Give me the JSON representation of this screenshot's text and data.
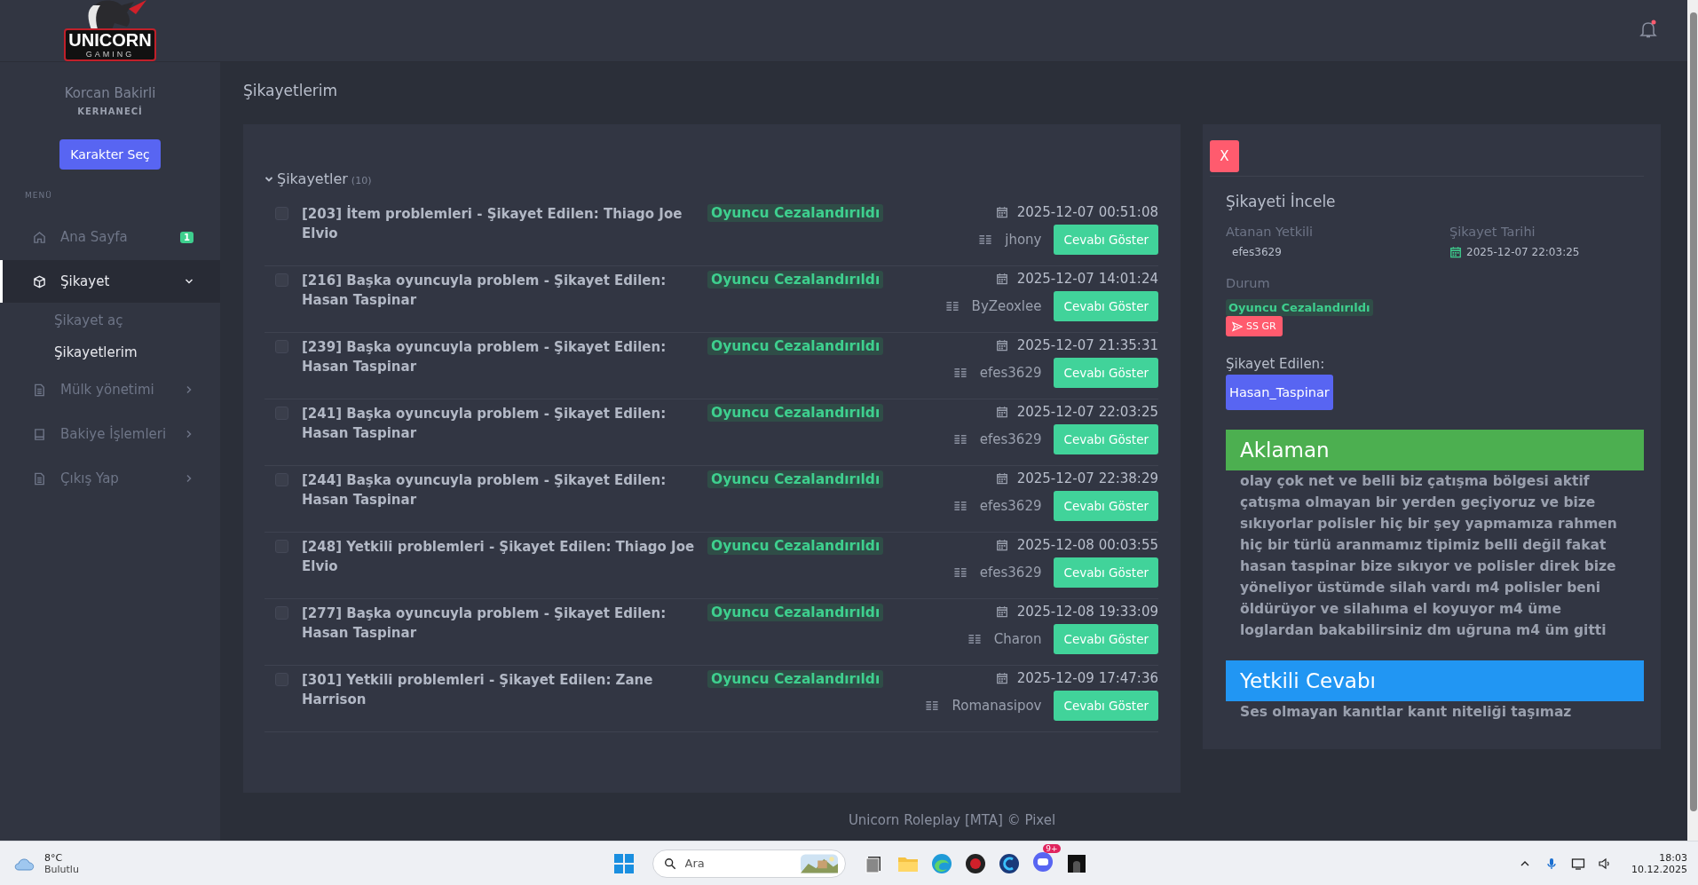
{
  "header": {
    "logo": {
      "name": "UNICORN",
      "tagline": "GAMING"
    },
    "notification": {
      "unread": true
    }
  },
  "sidebar": {
    "user_name": "Korcan Bakirli",
    "user_rank": "KERHANECİ",
    "character_button": "Karakter Seç",
    "menu_label": "MENÜ",
    "items": [
      {
        "label": "Ana Sayfa",
        "kind": "link",
        "badge": "1",
        "selected": false
      },
      {
        "label": "Şikayet",
        "kind": "group",
        "selected": true,
        "expanded": true,
        "children": [
          {
            "label": "Şikayet aç",
            "selected": false
          },
          {
            "label": "Şikayetlerim",
            "selected": true
          }
        ]
      },
      {
        "label": "Mülk yönetimi",
        "kind": "group",
        "selected": false,
        "expanded": false
      },
      {
        "label": "Bakiye İşlemleri",
        "kind": "group",
        "selected": false,
        "expanded": false
      },
      {
        "label": "Çıkış Yap",
        "kind": "group",
        "selected": false,
        "expanded": false
      }
    ]
  },
  "page_title": "Şikayetlerim",
  "complaints": {
    "title": "Şikayetler",
    "count": "(10)",
    "expanded": true,
    "rows": [
      {
        "title": "[203] İtem problemleri - Şikayet Edilen: Thiago Joe Elvio",
        "status": "Oyuncu Cezalandırıldı",
        "date": "2025-12-07 00:51:08",
        "staff": "jhony",
        "action_label": "Cevabı Göster",
        "checked": false
      },
      {
        "title": "[216] Başka oyuncuyla problem - Şikayet Edilen: Hasan Taspinar",
        "status": "Oyuncu Cezalandırıldı",
        "date": "2025-12-07 14:01:24",
        "staff": "ByZeoxlee",
        "action_label": "Cevabı Göster",
        "checked": false
      },
      {
        "title": "[239] Başka oyuncuyla problem - Şikayet Edilen: Hasan Taspinar",
        "status": "Oyuncu Cezalandırıldı",
        "date": "2025-12-07 21:35:31",
        "staff": "efes3629",
        "action_label": "Cevabı Göster",
        "checked": false
      },
      {
        "title": "[241] Başka oyuncuyla problem - Şikayet Edilen: Hasan Taspinar",
        "status": "Oyuncu Cezalandırıldı",
        "date": "2025-12-07 22:03:25",
        "staff": "efes3629",
        "action_label": "Cevabı Göster",
        "checked": false
      },
      {
        "title": "[244] Başka oyuncuyla problem - Şikayet Edilen: Hasan Taspinar",
        "status": "Oyuncu Cezalandırıldı",
        "date": "2025-12-07 22:38:29",
        "staff": "efes3629",
        "action_label": "Cevabı Göster",
        "checked": false
      },
      {
        "title": "[248] Yetkili problemleri - Şikayet Edilen: Thiago Joe Elvio",
        "status": "Oyuncu Cezalandırıldı",
        "date": "2025-12-08 00:03:55",
        "staff": "efes3629",
        "action_label": "Cevabı Göster",
        "checked": false
      },
      {
        "title": "[277] Başka oyuncuyla problem - Şikayet Edilen: Hasan Taspinar",
        "status": "Oyuncu Cezalandırıldı",
        "date": "2025-12-08 19:33:09",
        "staff": "Charon",
        "action_label": "Cevabı Göster",
        "checked": false
      },
      {
        "title": "[301] Yetkili problemleri - Şikayet Edilen: Zane Harrison",
        "status": "Oyuncu Cezalandırıldı",
        "date": "2025-12-09 17:47:36",
        "staff": "Romanasipov",
        "action_label": "Cevabı Göster",
        "checked": false
      }
    ]
  },
  "detail": {
    "close_button": "X",
    "title": "Şikayeti İncele",
    "assigned_label": "Atanan Yetkili",
    "assigned_value": "efes3629",
    "date_label": "Şikayet Tarihi",
    "date_value": "2025-12-07 22:03:25",
    "status_label": "Durum",
    "status": "Oyuncu Cezalandırıldı",
    "ss_button": "SS GR",
    "accused_label": "Şikayet Edilen:",
    "accused": "Hasan_Taspinar",
    "sections": [
      {
        "heading": "Aklaman",
        "color": "#4caf50",
        "body": "olay çok net ve belli biz çatışma bölgesi aktif çatışma olmayan bir yerden geçiyoruz ve bize sıkıyorlar polisler hiç bir şey yapmamıza rahmen hiç bir türlü aranmamız tipimiz belli değil fakat hasan taspinar bize sıkıyor ve polisler direk bize yöneliyor üstümde silah vardı m4 polisler beni öldürüyor ve silahıma el koyuyor m4 üme loglardan bakabilirsiniz dm uğruna m4 üm gitti"
      },
      {
        "heading": "Yetkili Cevabı",
        "color": "#2196f3",
        "body": "Ses olmayan kanıtlar kanıt niteliği taşımaz"
      }
    ]
  },
  "footer": "Unicorn Roleplay [MTA] © Pixel",
  "taskbar": {
    "temperature": "8°C",
    "weather": "Bulutlu",
    "search_placeholder": "Ara",
    "discord_badge": "9+",
    "time": "18:03",
    "date": "10.12.2025"
  }
}
